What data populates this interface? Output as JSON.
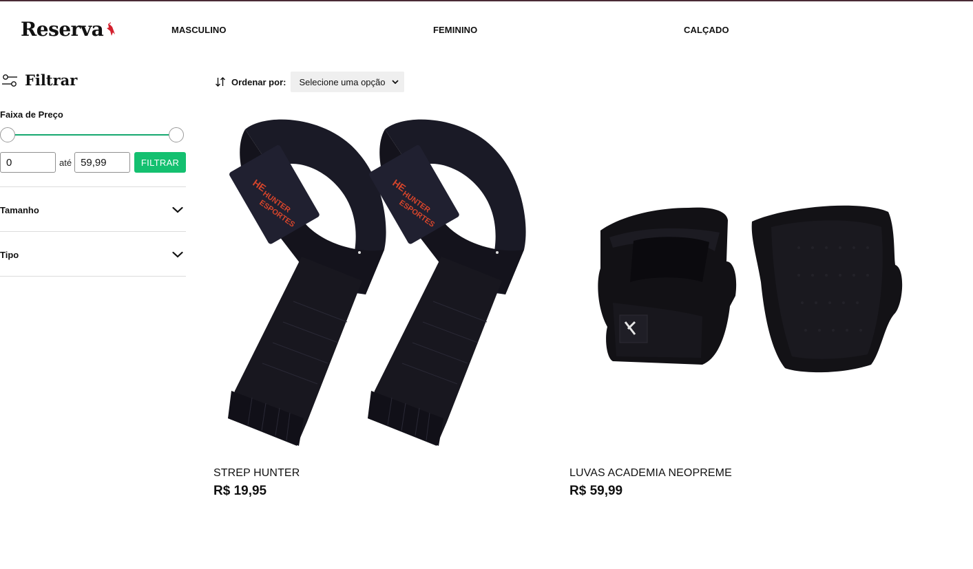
{
  "header": {
    "brand": "Reserva",
    "nav": [
      "MASCULINO",
      "FEMININO",
      "CALÇADO"
    ]
  },
  "sidebar": {
    "title": "Filtrar",
    "price_filter": {
      "label": "Faixa de Preço",
      "min_value": "0",
      "max_value": "59,99",
      "separator": "até",
      "button_label": "FILTRAR"
    },
    "accordions": [
      {
        "label": "Tamanho"
      },
      {
        "label": "Tipo"
      }
    ]
  },
  "sort": {
    "label": "Ordenar por:",
    "selected": "Selecione uma opção"
  },
  "products": [
    {
      "name": "STREP HUNTER",
      "price": "R$ 19,95",
      "image": "lifting-straps-image"
    },
    {
      "name": "LUVAS ACADEMIA NEOPREME",
      "price": "R$ 59,99",
      "image": "gym-gloves-image"
    }
  ],
  "colors": {
    "accent": "#14c070",
    "slider_track": "#14a86f",
    "logo_bird": "#d3202e",
    "top_border": "#4a2a35",
    "product_dark": "#15141c",
    "strap_logo": "#d6452b"
  },
  "icons": [
    "filter-sliders-icon",
    "sort-arrows-icon",
    "chevron-down-icon",
    "bird-logo-icon"
  ]
}
